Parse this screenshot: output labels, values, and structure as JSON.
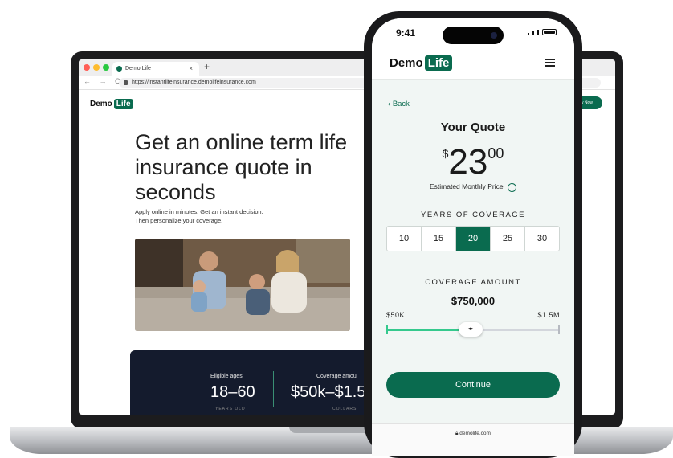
{
  "colors": {
    "brand_green": "#0a6b4f",
    "slider_green": "#35c98d",
    "panel_navy": "#141b2d"
  },
  "laptop": {
    "tab_title": "Demo Life",
    "tab_close": "×",
    "tab_new": "+",
    "nav_buttons": "← → C",
    "url": "https://instantlifeinsurance.demolifeinsurance.com",
    "logo": {
      "demo": "Demo",
      "life": "Life"
    },
    "hero_title": "Get an online term life insurance quote in seconds",
    "hero_subtitle_line1": "Apply online in minutes. Get an instant decision.",
    "hero_subtitle_line2": "Then personalize your coverage.",
    "stats": [
      {
        "label": "Eligible ages",
        "value": "18–60",
        "foot": "YEARS OLD"
      },
      {
        "label": "Coverage amou",
        "value": "$50k–$1.5N",
        "foot": "COLLARS"
      }
    ],
    "cta_partial": "y Now"
  },
  "phone": {
    "time": "9:41",
    "logo": {
      "demo": "Demo",
      "life": "Life"
    },
    "menu_icon": "hamburger-icon",
    "back_label": "Back",
    "quote_title": "Your Quote",
    "price": {
      "currency": "$",
      "dollars": "23",
      "cents": "00"
    },
    "price_caption": "Estimated Monthly Price",
    "years_label": "YEARS OF COVERAGE",
    "years_options": [
      "10",
      "15",
      "20",
      "25",
      "30"
    ],
    "years_selected": "20",
    "amount_label": "COVERAGE AMOUNT",
    "amount_value": "$750,000",
    "range_min": "$50K",
    "range_max": "$1.5M",
    "slider_fraction": 0.48,
    "slider_thumb": "◂▸",
    "continue_label": "Continue",
    "domain": "demolife.com"
  }
}
